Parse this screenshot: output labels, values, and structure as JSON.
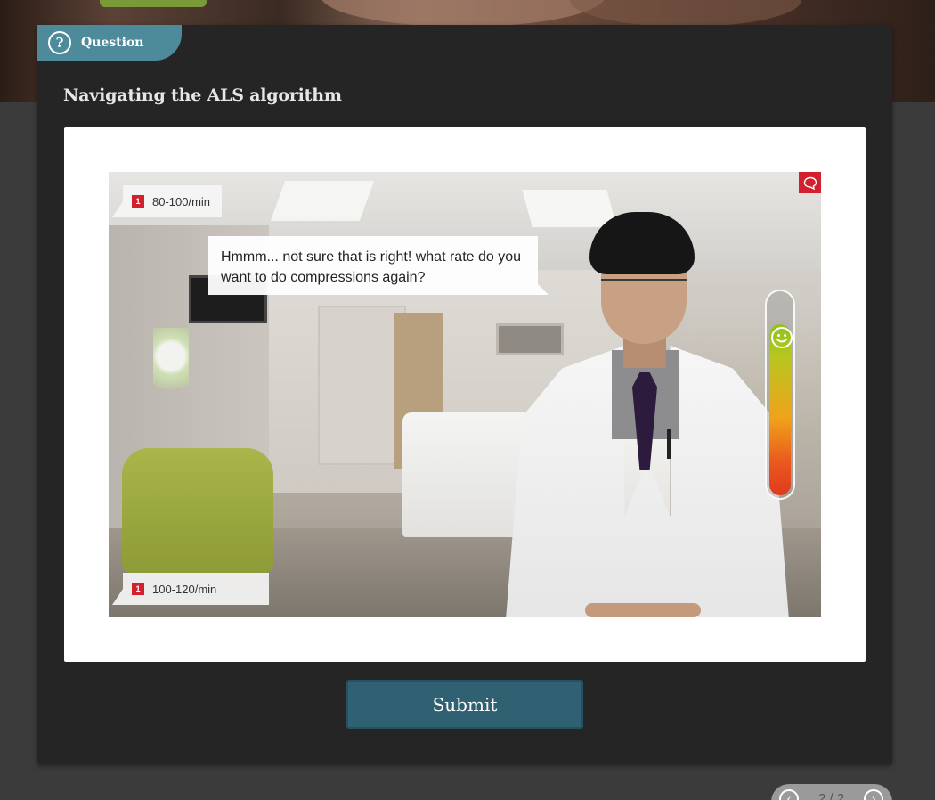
{
  "question_tab": {
    "label": "Question",
    "icon": "question-circle-icon"
  },
  "title": "Navigating the ALS algorithm",
  "scene": {
    "speech": "Hmmm... not sure that is right! what rate do you want to do compressions again?",
    "choices": [
      {
        "badge": "1",
        "label": "80-100/min"
      },
      {
        "badge": "1",
        "label": "100-120/min"
      }
    ],
    "meter": {
      "level": 0.85,
      "face_icon": "smiley-face-icon"
    },
    "corner_icon": "speech-bubble-icon"
  },
  "submit_label": "Submit",
  "pager": {
    "text": "2 / 2",
    "prev_icon": "chevron-left-icon",
    "next_icon": "chevron-right-icon"
  },
  "colors": {
    "accent": "#4d8b9b",
    "submit": "#2f6172",
    "badge_red": "#d3202f",
    "card": "#252525"
  }
}
